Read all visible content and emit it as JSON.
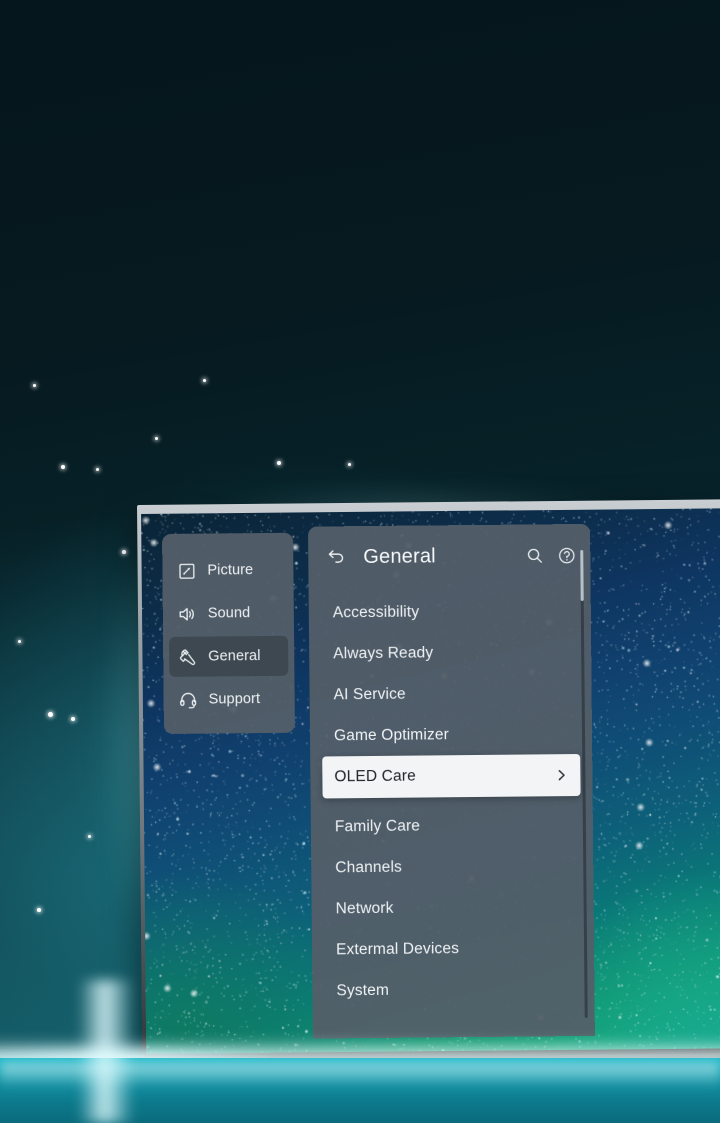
{
  "scene": {
    "device": "oled-tv",
    "wallpaper": "starfield-gradient",
    "accent_teal": "#17a9bb",
    "panel_color": "#535e68",
    "highlight_color": "#f2f4f5"
  },
  "sidebar": {
    "items": [
      {
        "label": "Picture",
        "icon": "picture-icon",
        "selected": false
      },
      {
        "label": "Sound",
        "icon": "sound-icon",
        "selected": false
      },
      {
        "label": "General",
        "icon": "wrench-icon",
        "selected": true
      },
      {
        "label": "Support",
        "icon": "headset-icon",
        "selected": false
      }
    ]
  },
  "main": {
    "back_icon": "back-arrow-icon",
    "title": "General",
    "header_icons": [
      {
        "name": "search-icon",
        "glyph": "search"
      },
      {
        "name": "help-icon",
        "glyph": "question-circle"
      }
    ],
    "menu": [
      {
        "label": "Accessibility",
        "highlighted": false,
        "chevron": false
      },
      {
        "label": "Always Ready",
        "highlighted": false,
        "chevron": false
      },
      {
        "label": "AI Service",
        "highlighted": false,
        "chevron": false
      },
      {
        "label": "Game Optimizer",
        "highlighted": false,
        "chevron": false
      },
      {
        "label": "OLED Care",
        "highlighted": true,
        "chevron": true
      },
      {
        "label": "Family Care",
        "highlighted": false,
        "chevron": false
      },
      {
        "label": "Channels",
        "highlighted": false,
        "chevron": false
      },
      {
        "label": "Network",
        "highlighted": false,
        "chevron": false
      },
      {
        "label": "Extermal Devices",
        "highlighted": false,
        "chevron": false
      },
      {
        "label": "System",
        "highlighted": false,
        "chevron": false
      }
    ],
    "scrollbar": {
      "name": "menu-scrollbar",
      "thumb_position_pct": 0,
      "thumb_size_pct": 11
    }
  }
}
